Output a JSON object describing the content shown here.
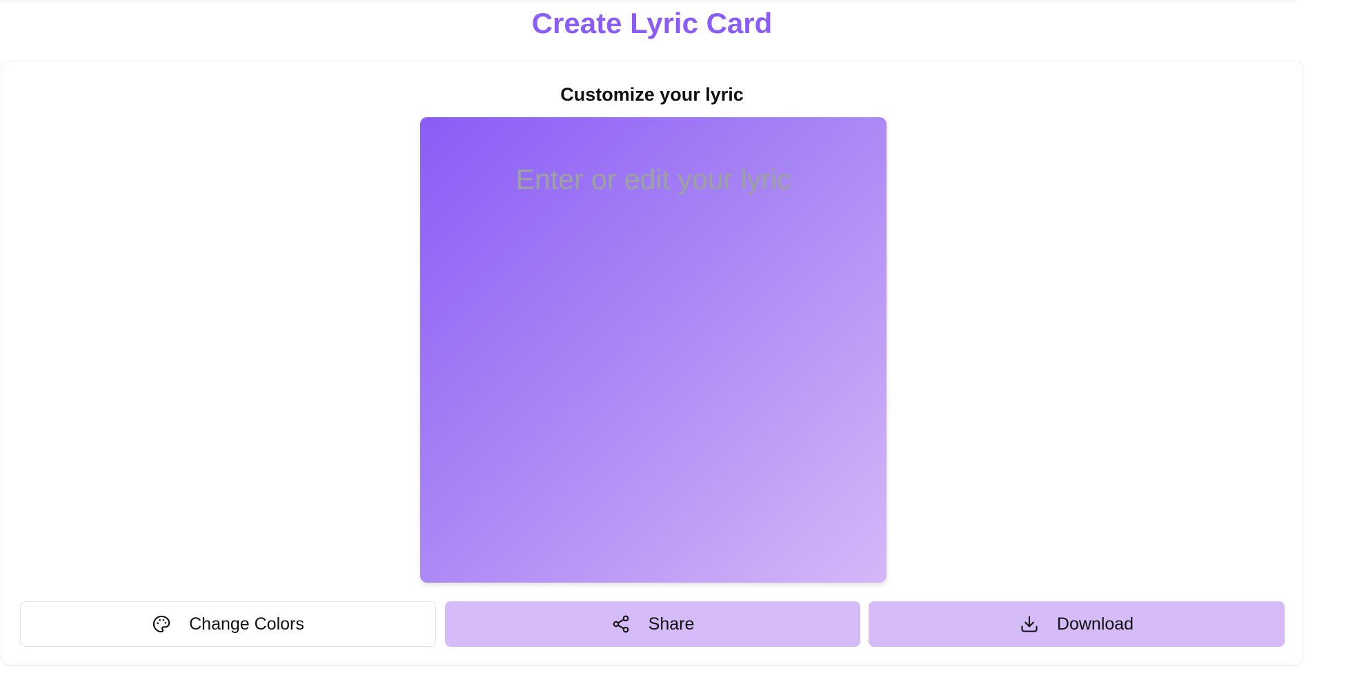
{
  "header": {
    "title": "Create Lyric Card"
  },
  "editor": {
    "subtitle": "Customize your lyric",
    "lyric_value": "",
    "lyric_placeholder": "Enter or edit your lyric"
  },
  "actions": {
    "change_colors_label": "Change Colors",
    "change_colors_icon": "palette-icon",
    "share_label": "Share",
    "share_icon": "share-icon",
    "download_label": "Download",
    "download_icon": "download-icon"
  },
  "colors": {
    "accent": "#8b5cf6",
    "gradient_start": "#8b5cf6",
    "gradient_end": "#d4b8f8",
    "button_fill": "#d5bbf7",
    "placeholder": "#9ba49c"
  }
}
